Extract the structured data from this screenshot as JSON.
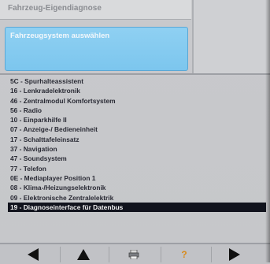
{
  "header": {
    "title": "Fahrzeug-Eigendiagnose"
  },
  "selector": {
    "label": "Fahrzeugsystem auswählen"
  },
  "list": {
    "items": [
      "5C - Spurhalteassistent",
      "16 - Lenkradelektronik",
      "46 - Zentralmodul Komfortsystem",
      "56 - Radio",
      "10 - Einparkhilfe II",
      "07 - Anzeige-/ Bedieneinheit",
      "17 - Schalttafeleinsatz",
      "37 - Navigation",
      "47 - Soundsystem",
      "77 - Telefon",
      "0E - Mediaplayer Position 1",
      "08 - Klima-/Heizungselektronik",
      "09 - Elektronische Zentralelektrik",
      "19 - Diagnoseinterface für Datenbus"
    ],
    "selected_index": 13
  },
  "toolbar": {
    "buttons": [
      {
        "name": "back-button",
        "icon": "arrow-left-icon"
      },
      {
        "name": "up-button",
        "icon": "arrow-up-icon"
      },
      {
        "name": "print-button",
        "icon": "printer-icon"
      },
      {
        "name": "help-button",
        "icon": "help-icon",
        "glyph": "?"
      },
      {
        "name": "forward-button",
        "icon": "arrow-right-icon"
      }
    ]
  },
  "colors": {
    "accent": "#7cc6ee",
    "selected_row": "#11131d",
    "help_icon": "#d98a1a"
  }
}
